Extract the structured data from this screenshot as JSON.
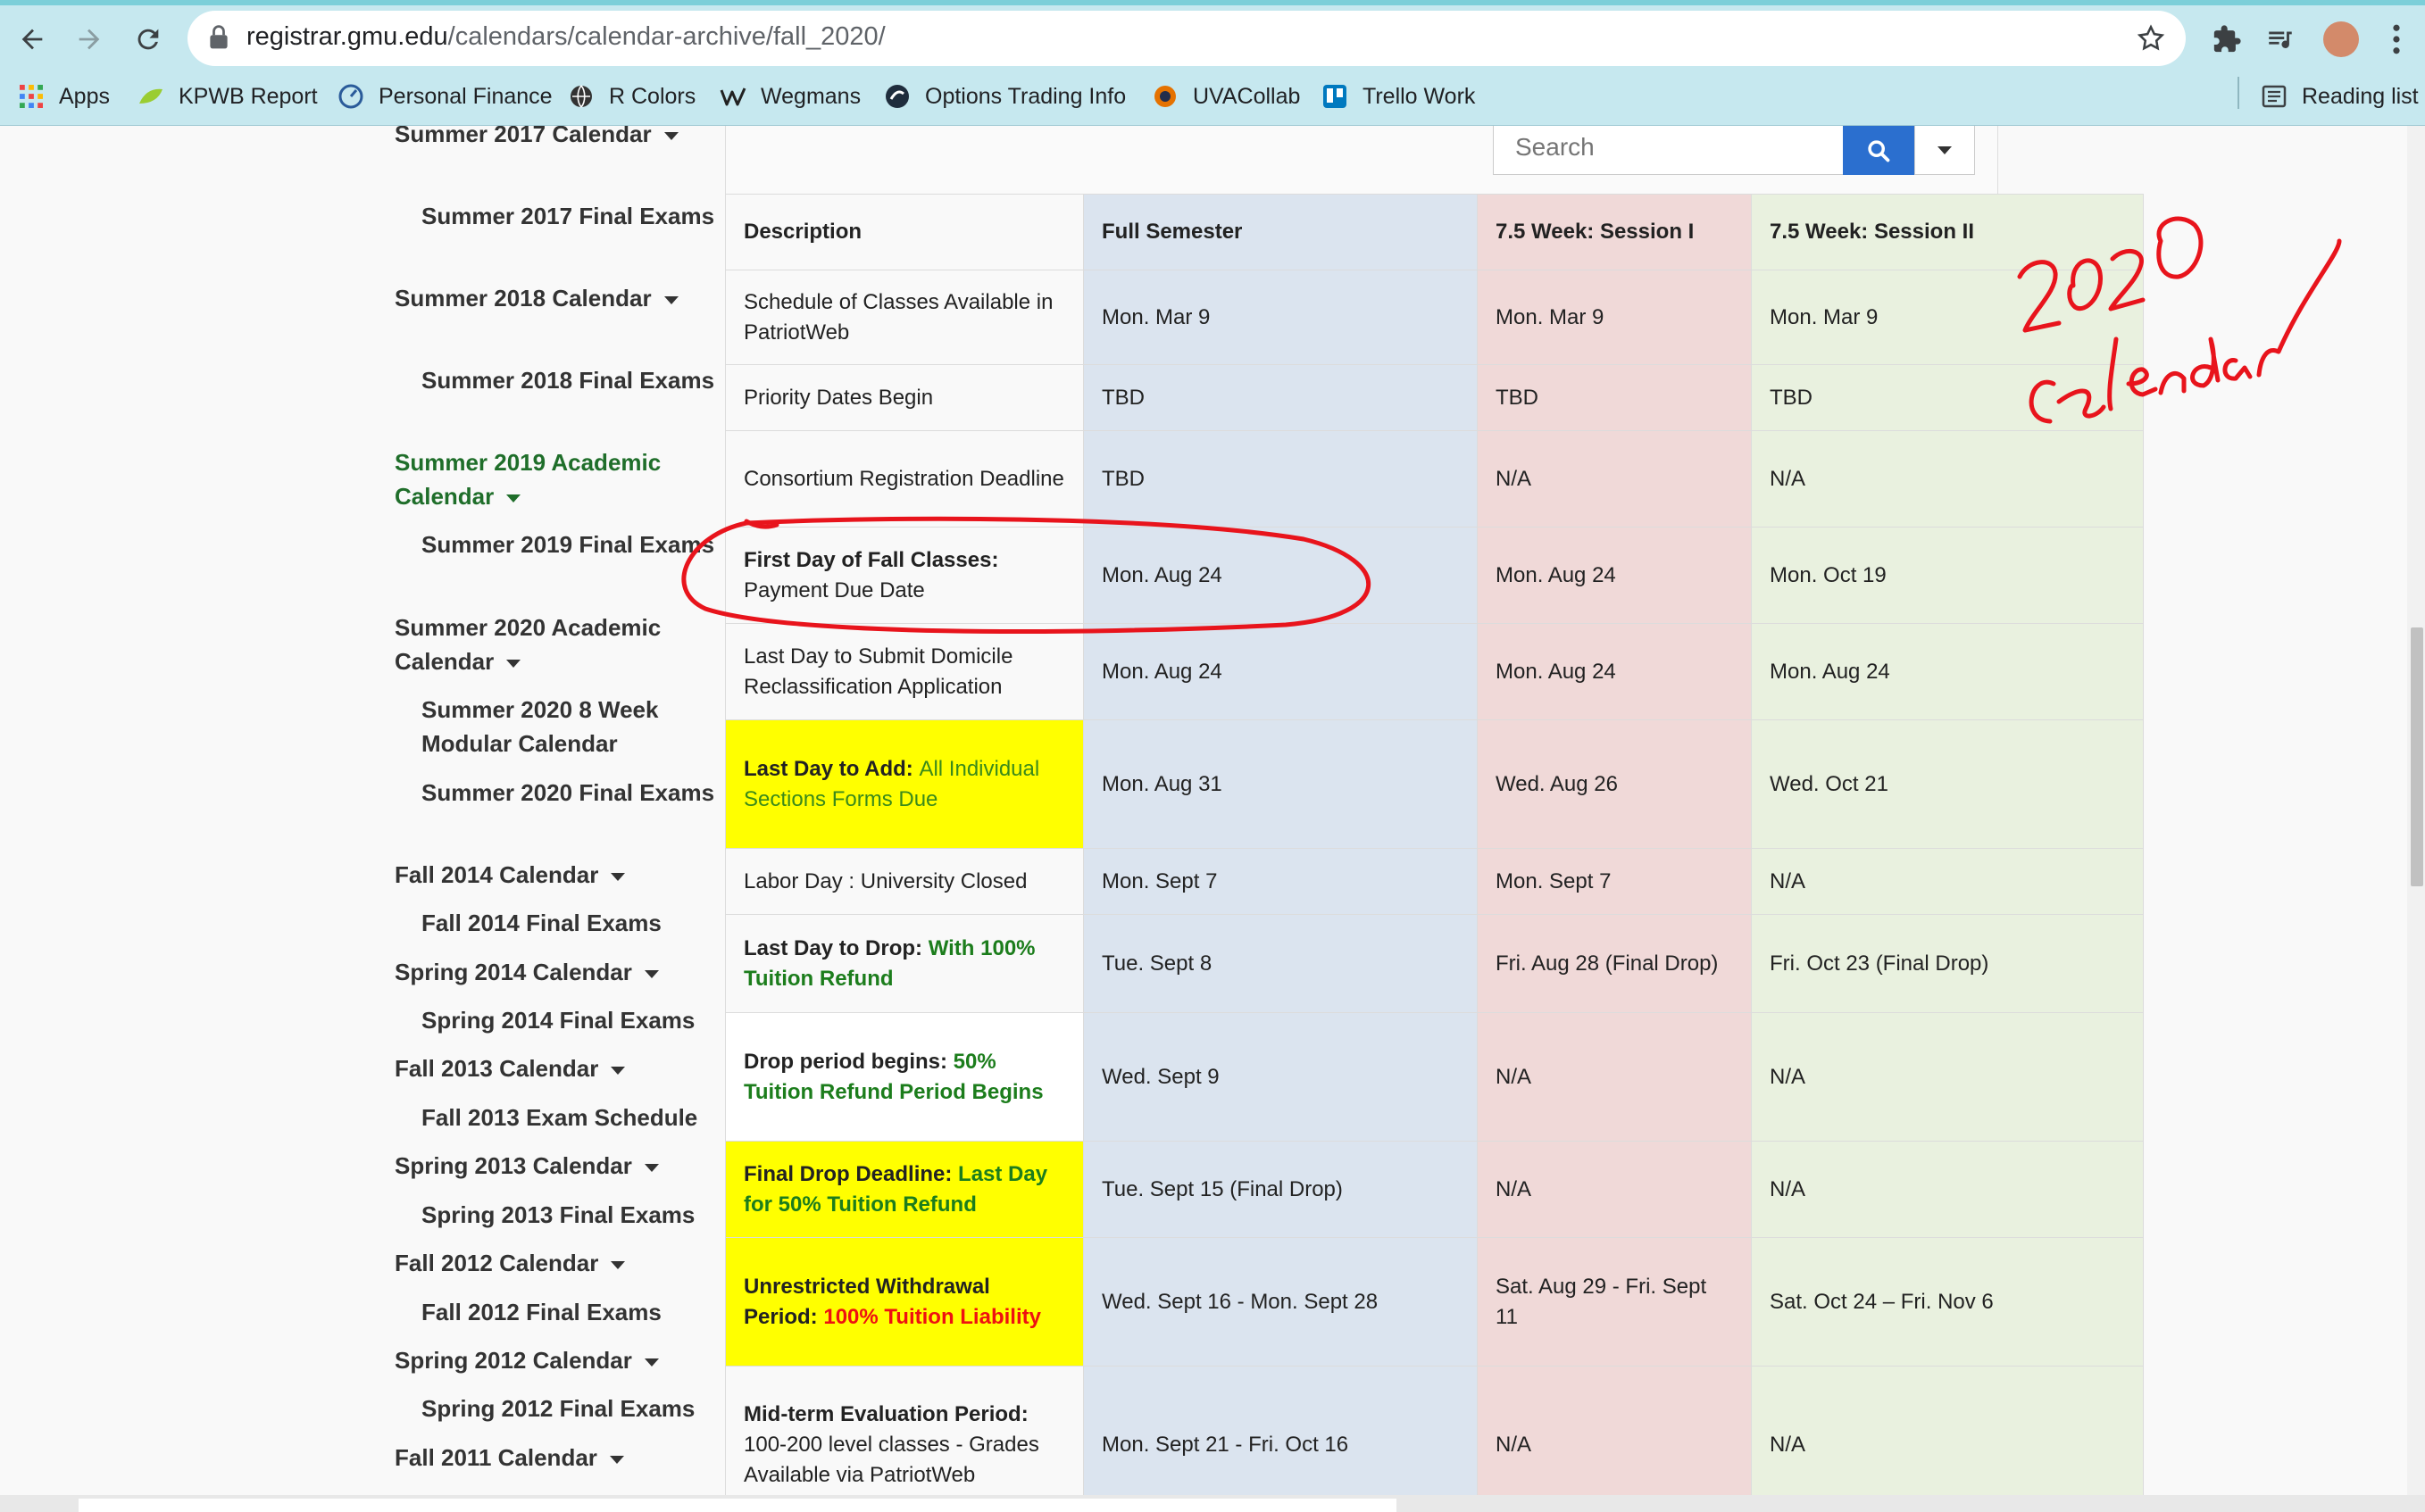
{
  "browser": {
    "url_host": "registrar.gmu.edu",
    "url_path": "/calendars/calendar-archive/fall_2020/",
    "bookmarks": [
      "Apps",
      "KPWB Report",
      "Personal Finance",
      "R Colors",
      "Wegmans",
      "Options Trading Info",
      "UVACollab",
      "Trello Work"
    ],
    "reading_list": "Reading list"
  },
  "sidebar": {
    "items": [
      {
        "label": "Summer 2017 Calendar",
        "level": 1,
        "caret": true,
        "green": false
      },
      {
        "label": "Summer 2017 Final Exams",
        "level": 2
      },
      {
        "label": "Summer 2018 Calendar",
        "level": 1,
        "caret": true
      },
      {
        "label": "Summer 2018 Final Exams",
        "level": 2
      },
      {
        "label": "Summer 2019 Academic Calendar",
        "level": 1,
        "caret": true,
        "green": true
      },
      {
        "label": "Summer 2019 Final Exams",
        "level": 2
      },
      {
        "label": "Summer 2020 Academic Calendar",
        "level": 1,
        "caret": true
      },
      {
        "label": "Summer 2020 8 Week Modular Calendar",
        "level": 2
      },
      {
        "label": "Summer 2020 Final Exams",
        "level": 2
      },
      {
        "label": "Fall 2014 Calendar",
        "level": 1,
        "caret": true
      },
      {
        "label": "Fall 2014 Final Exams",
        "level": 2
      },
      {
        "label": "Spring 2014 Calendar",
        "level": 1,
        "caret": true
      },
      {
        "label": "Spring 2014 Final Exams",
        "level": 2
      },
      {
        "label": "Fall 2013 Calendar",
        "level": 1,
        "caret": true
      },
      {
        "label": "Fall 2013 Exam Schedule",
        "level": 2
      },
      {
        "label": "Spring 2013 Calendar",
        "level": 1,
        "caret": true
      },
      {
        "label": "Spring 2013 Final Exams",
        "level": 2
      },
      {
        "label": "Fall 2012 Calendar",
        "level": 1,
        "caret": true
      },
      {
        "label": "Fall 2012 Final Exams",
        "level": 2
      },
      {
        "label": "Spring 2012 Calendar",
        "level": 1,
        "caret": true
      },
      {
        "label": "Spring 2012 Final Exams",
        "level": 2
      },
      {
        "label": "Fall 2011 Calendar",
        "level": 1,
        "caret": true
      }
    ]
  },
  "search": {
    "placeholder": "Search"
  },
  "table": {
    "headers": [
      "Description",
      "Full Semester",
      "7.5 Week: Session I",
      "7.5 Week: Session II"
    ],
    "rows": [
      {
        "desc": "Schedule of Classes Available in PatriotWeb",
        "v": [
          "Mon. Mar 9",
          "Mon. Mar 9",
          "Mon. Mar 9"
        ]
      },
      {
        "desc": "Priority Dates Begin",
        "v": [
          "TBD",
          "TBD",
          "TBD"
        ]
      },
      {
        "desc": "Consortium Registration Deadline",
        "v": [
          "TBD",
          "N/A",
          "N/A"
        ]
      },
      {
        "desc_bold": "First Day of Fall Classes:",
        "desc_rest": "Payment Due Date",
        "v": [
          "Mon. Aug 24",
          "Mon. Aug 24",
          "Mon. Oct 19"
        ]
      },
      {
        "desc": "Last Day to Submit Domicile Reclassification Application",
        "v": [
          "Mon. Aug 24",
          "Mon. Aug 24",
          "Mon. Aug 24"
        ]
      },
      {
        "desc_bold": "Last Day to Add:",
        "desc_rest": "All Individual Sections Forms Due",
        "v": [
          "Mon. Aug 31",
          "Wed. Aug 26",
          "Wed. Oct 21"
        ]
      },
      {
        "desc": "Labor Day : University Closed",
        "v": [
          "Mon. Sept 7",
          "Mon. Sept 7",
          "N/A"
        ]
      },
      {
        "desc_bold": "Last Day to Drop:",
        "desc_rest": "With 100% Tuition Refund",
        "v": [
          "Tue. Sept 8",
          "Fri. Aug 28 (Final Drop)",
          "Fri. Oct 23 (Final Drop)"
        ]
      },
      {
        "desc_bold": "Drop period begins:",
        "desc_rest": "50% Tuition Refund Period Begins",
        "v": [
          "Wed. Sept 9",
          "N/A",
          "N/A"
        ]
      },
      {
        "desc_bold": "Final Drop Deadline:",
        "desc_rest": "Last Day for 50% Tuition Refund",
        "v": [
          "Tue. Sept 15 (Final Drop)",
          "N/A",
          "N/A"
        ]
      },
      {
        "desc_bold": "Unrestricted Withdrawal Period:",
        "desc_rest": "100% Tuition Liability",
        "v": [
          "Wed. Sept 16 - Mon. Sept 28",
          "Sat. Aug 29 - Fri. Sept 11",
          "Sat. Oct 24 – Fri. Nov 6"
        ]
      },
      {
        "desc_bold": "Mid-term Evaluation Period:",
        "desc_rest": "100-200 level classes - Grades Available via PatriotWeb",
        "v": [
          "Mon. Sept 21 - Fri. Oct 16",
          "N/A",
          "N/A"
        ]
      }
    ]
  },
  "colors": {
    "annotation_red": "#e8141c",
    "accent_blue": "#2b6fcf",
    "green_text": "#1c7d1c"
  }
}
